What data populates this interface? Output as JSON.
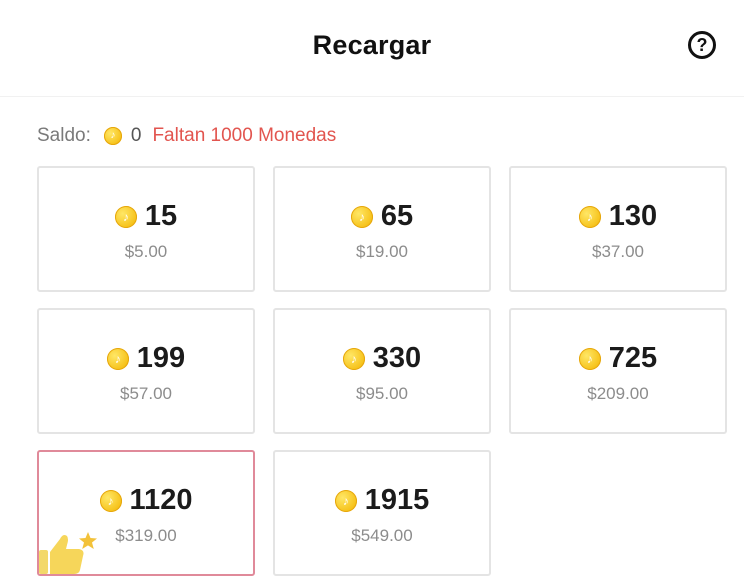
{
  "header": {
    "title": "Recargar",
    "help_icon": "question-circle-icon"
  },
  "balance": {
    "label": "Saldo:",
    "amount": "0",
    "missing": "Faltan 1000 Monedas",
    "coin_icon": "coin-icon"
  },
  "colors": {
    "coin": "#f6c21a",
    "warning_text": "#e2554f",
    "selected_border": "#e08a9a",
    "card_border": "#e4e4e4"
  },
  "packages": [
    {
      "coins": "15",
      "price": "$5.00",
      "selected": false
    },
    {
      "coins": "65",
      "price": "$19.00",
      "selected": false
    },
    {
      "coins": "130",
      "price": "$37.00",
      "selected": false
    },
    {
      "coins": "199",
      "price": "$57.00",
      "selected": false
    },
    {
      "coins": "330",
      "price": "$95.00",
      "selected": false
    },
    {
      "coins": "725",
      "price": "$209.00",
      "selected": false
    },
    {
      "coins": "1120",
      "price": "$319.00",
      "selected": true,
      "badge": "thumbs-up-star-icon"
    },
    {
      "coins": "1915",
      "price": "$549.00",
      "selected": false
    }
  ]
}
